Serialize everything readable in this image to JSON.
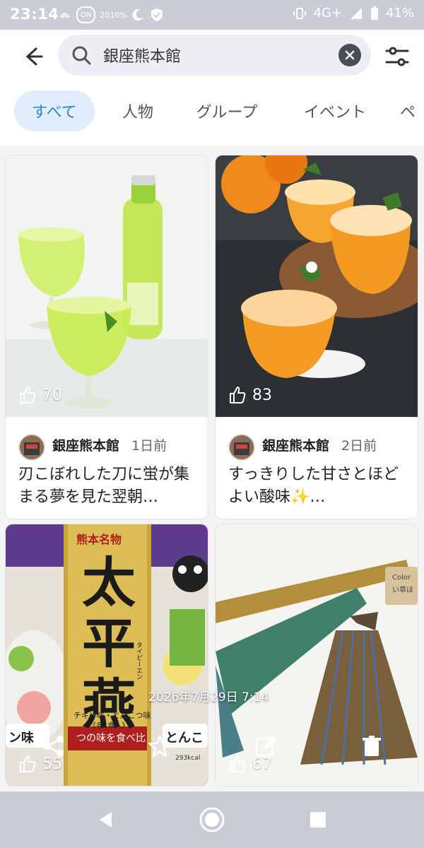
{
  "status_bar": {
    "time": "23:14",
    "network": "4G+",
    "battery": "41%",
    "left_icons": [
      "nfc-icon",
      "data-icon",
      "moon-icon",
      "shield-check-icon"
    ],
    "pill_text": "ON",
    "pill_percent": "2010%"
  },
  "search": {
    "query": "銀座熊本館",
    "placeholder": "検索"
  },
  "tabs": [
    {
      "label": "すべて",
      "active": true
    },
    {
      "label": "人物",
      "active": false
    },
    {
      "label": "グループ",
      "active": false
    },
    {
      "label": "イベント",
      "active": false
    },
    {
      "label": "ペ",
      "active": false
    }
  ],
  "posts": [
    {
      "likes": "70",
      "author": "銀座熊本館",
      "ago": "1日前",
      "excerpt": "刃こぼれした刀に蛍が集まる夢を見た翌朝…",
      "image": "green-soda-drink"
    },
    {
      "likes": "83",
      "author": "銀座熊本館",
      "ago": "2日前",
      "excerpt": "すっきりした甘さとほどよい酸味✨…",
      "image": "orange-jelly-cups"
    },
    {
      "likes": "55",
      "image": "taipien-noodle-package",
      "package_title": "熊本名物",
      "package_name": "太平燕",
      "package_reading": "タイピーエン",
      "package_flavors": "チキン味・とんこつ味",
      "package_count": "《各1食入》",
      "package_side_left": "ン味",
      "package_side_right": "とんこ",
      "package_calorie": "293kcal",
      "package_bottom": "つの味を食べ比"
    },
    {
      "likes": "67",
      "image": "woven-brooms",
      "tag_text": "Color",
      "tag_sub": "い草ほ"
    }
  ],
  "overlay": {
    "timestamp": "2026年7月29日 7:14",
    "actions": [
      "share-icon",
      "star-icon",
      "edit-icon",
      "trash-icon"
    ]
  },
  "nav": {
    "buttons": [
      "back",
      "home",
      "recents"
    ]
  },
  "colors": {
    "accent": "#2f83d6",
    "tab_active_bg": "#e0eefb",
    "system_bar": "#c9ced4"
  }
}
